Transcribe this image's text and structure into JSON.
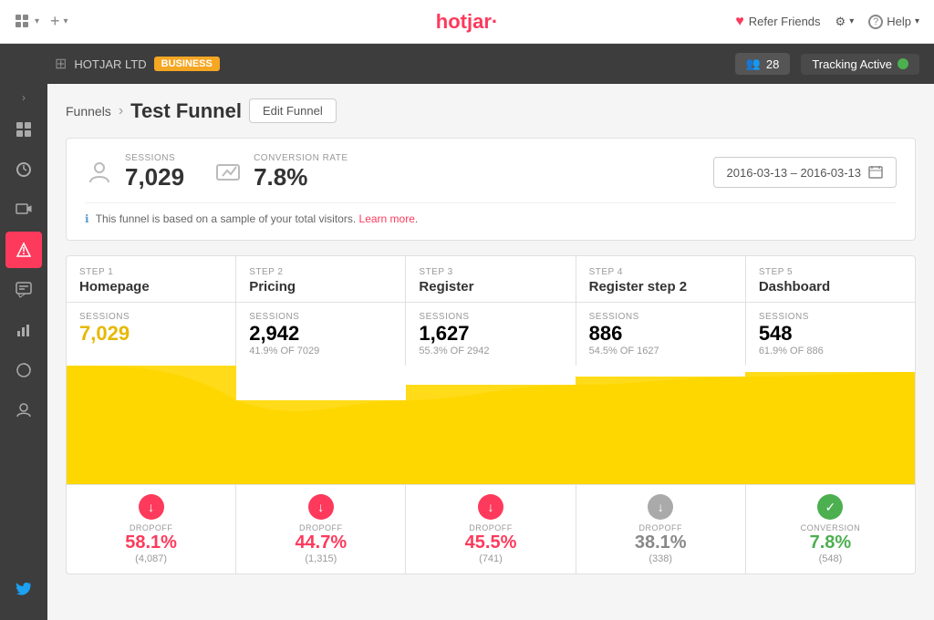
{
  "topnav": {
    "logo": "hotjar",
    "logo_dot": ".",
    "grid_label": "",
    "plus_label": "+",
    "refer_friends": "Refer Friends",
    "settings_label": "Settings",
    "help_label": "Help"
  },
  "subheader": {
    "brand": "HOTJAR LTD",
    "plan": "BUSINESS",
    "users_count": "28",
    "tracking_label": "Tracking Active"
  },
  "breadcrumb": {
    "parent": "Funnels",
    "current": "Test Funnel",
    "edit_btn": "Edit Funnel"
  },
  "stats": {
    "sessions_label": "SESSIONS",
    "sessions_value": "7,029",
    "conversion_label": "CONVERSION RATE",
    "conversion_value": "7.8%",
    "date_range": "2016-03-13 – 2016-03-13",
    "info_text": "This funnel is based on a sample of your total visitors.",
    "learn_more": "Learn more"
  },
  "steps": [
    {
      "step": "STEP 1",
      "name": "Homepage",
      "sessions_label": "SESSIONS",
      "sessions_value": "7,029",
      "sessions_sub": "",
      "dropoff_type": "red",
      "dropoff_label": "DROPOFF",
      "dropoff_pct": "58.1%",
      "dropoff_count": "(4,087)"
    },
    {
      "step": "STEP 2",
      "name": "Pricing",
      "sessions_label": "SESSIONS",
      "sessions_value": "2,942",
      "sessions_sub": "41.9% OF 7029",
      "dropoff_type": "red",
      "dropoff_label": "DROPOFF",
      "dropoff_pct": "44.7%",
      "dropoff_count": "(1,315)"
    },
    {
      "step": "STEP 3",
      "name": "Register",
      "sessions_label": "SESSIONS",
      "sessions_value": "1,627",
      "sessions_sub": "55.3% OF 2942",
      "dropoff_type": "red",
      "dropoff_label": "DROPOFF",
      "dropoff_pct": "45.5%",
      "dropoff_count": "(741)"
    },
    {
      "step": "STEP 4",
      "name": "Register step 2",
      "sessions_label": "SESSIONS",
      "sessions_value": "886",
      "sessions_sub": "54.5% OF 1627",
      "dropoff_type": "gray",
      "dropoff_label": "DROPOFF",
      "dropoff_pct": "38.1%",
      "dropoff_count": "(338)"
    },
    {
      "step": "STEP 5",
      "name": "Dashboard",
      "sessions_label": "SESSIONS",
      "sessions_value": "548",
      "sessions_sub": "61.9% OF 886",
      "dropoff_type": "green",
      "dropoff_label": "CONVERSION",
      "dropoff_pct": "7.8%",
      "dropoff_count": "(548)"
    }
  ],
  "sidebar": {
    "items": [
      {
        "icon": "⊞",
        "name": "dashboard",
        "active": false
      },
      {
        "icon": "↺",
        "name": "activity",
        "active": false
      },
      {
        "icon": "▣",
        "name": "recordings",
        "active": false
      },
      {
        "icon": "▽",
        "name": "heatmaps",
        "active": true
      },
      {
        "icon": "✎",
        "name": "feedback",
        "active": false
      },
      {
        "icon": "▦",
        "name": "funnels",
        "active": false
      },
      {
        "icon": "◑",
        "name": "polls",
        "active": false
      },
      {
        "icon": "👤",
        "name": "users",
        "active": false
      }
    ]
  }
}
